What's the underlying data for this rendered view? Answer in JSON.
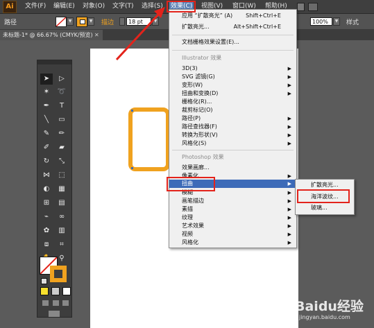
{
  "app": {
    "logo": "Ai"
  },
  "menubar": {
    "items": [
      "文件(F)",
      "编辑(E)",
      "对象(O)",
      "文字(T)",
      "选择(S)",
      "效果(C)",
      "视图(V)",
      "窗口(W)",
      "帮助(H)"
    ],
    "active_index": 5
  },
  "controlbar": {
    "object_label": "路径",
    "stroke_label": "描边",
    "stroke_value": "18 pt",
    "opacity_value": "100%",
    "style_label": "样式"
  },
  "document": {
    "tab_title": "未标题-1* @ 66.67% (CMYK/预览)"
  },
  "effect_menu": {
    "apply_last": {
      "label": "应用 “扩散亮光” (A)",
      "shortcut": "Shift+Ctrl+E"
    },
    "last_effect": {
      "label": "扩散亮光...",
      "shortcut": "Alt+Shift+Ctrl+E"
    },
    "raster_settings": "文档栅格效果设置(E)...",
    "illustrator_header": "Illustrator 效果",
    "illustrator_items": [
      "3D(3)",
      "SVG 滤镜(G)",
      "变形(W)",
      "扭曲和变换(D)",
      "栅格化(R)...",
      "裁剪标记(O)",
      "路径(P)",
      "路径查找器(F)",
      "转换为形状(V)",
      "风格化(S)"
    ],
    "photoshop_header": "Photoshop 效果",
    "photoshop_items": [
      "效果画廊...",
      "像素化",
      "扭曲",
      "模糊",
      "画笔描边",
      "素描",
      "纹理",
      "艺术效果",
      "视频",
      "风格化"
    ],
    "highlighted_item": "扭曲"
  },
  "distort_submenu": {
    "items": [
      "扩散亮光...",
      "海洋波纹...",
      "玻璃..."
    ],
    "highlighted_item": "海洋波纹..."
  },
  "watermark": {
    "text": "Baidu经验",
    "subtext": "jingyan.baidu.com"
  },
  "colors": {
    "accent_orange": "#f0a21f",
    "highlight_blue": "#3d6bb8",
    "annotation_red": "#e3231b"
  }
}
